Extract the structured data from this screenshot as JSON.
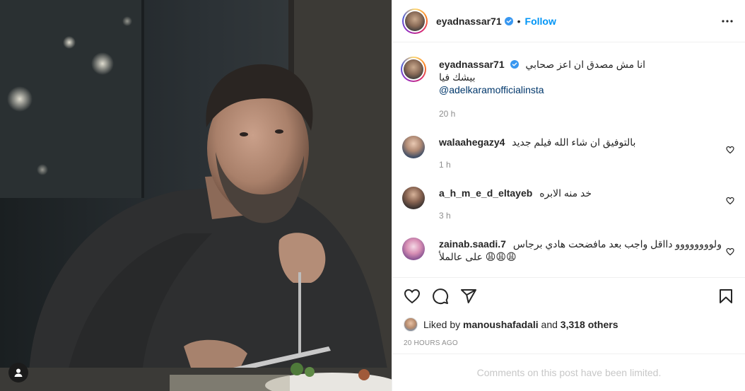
{
  "post": {
    "author": "eyadnassar71",
    "follow_label": "Follow",
    "dot": "•",
    "caption": {
      "username": "eyadnassar71",
      "line1": "انا مش مصدق ان اعز صحابي",
      "line2": "بيشك فيا",
      "mention": "@adelkaramofficialinsta",
      "time": "20 h"
    },
    "comments": [
      {
        "username": "walaahegazy4",
        "text": "بالتوفيق ان شاء الله فيلم جديد",
        "time": "1 h"
      },
      {
        "username": "a_h_m_e_d_eltayeb",
        "text": "خد منه الابره",
        "time": "3 h"
      },
      {
        "username": "zainab.saadi.7",
        "text": "ولوووووووو دااقل واجب بعد مافضحت هادي برجاس",
        "text2": "😩😩😩 على عالملأ",
        "time": ""
      }
    ],
    "likes": {
      "prefix": "Liked by",
      "user": "manoushafadali",
      "connector": "and",
      "others": "3,318 others"
    },
    "posted_ago": "20 HOURS AGO",
    "comments_limited": "Comments on this post have been limited."
  },
  "colors": {
    "accent": "#0095f6",
    "verified": "#3897f0",
    "mention": "#00376b",
    "muted": "#8e8e8e",
    "limited_text": "#c7c7c7"
  },
  "icons": [
    "user-tag-icon",
    "verified-badge-icon",
    "more-options-icon",
    "heart-icon",
    "comment-icon",
    "share-icon",
    "bookmark-icon",
    "small-heart-icon"
  ]
}
